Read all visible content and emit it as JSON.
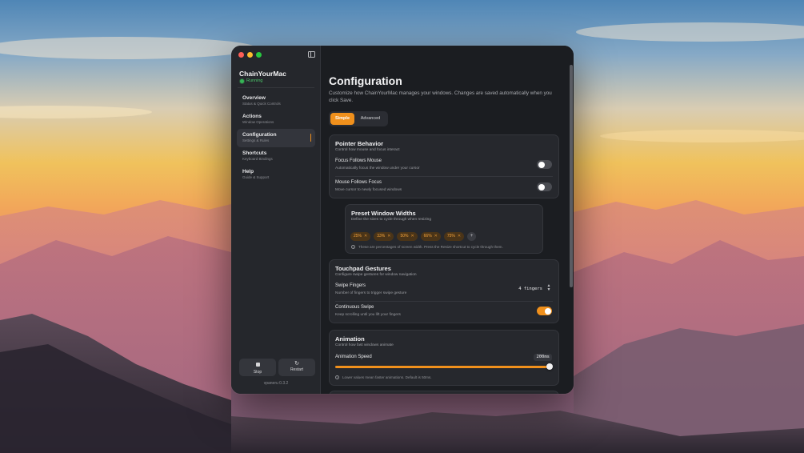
{
  "sidebar": {
    "app_name": "ChainYourMac",
    "status": "Running",
    "items": [
      {
        "label": "Overview",
        "sub": "Status & Quick Controls"
      },
      {
        "label": "Actions",
        "sub": "Window Operations"
      },
      {
        "label": "Configuration",
        "sub": "Settings & Rules"
      },
      {
        "label": "Shortcuts",
        "sub": "Keyboard Bindings"
      },
      {
        "label": "Help",
        "sub": "Guide & Support"
      }
    ],
    "stop_label": "Stop",
    "restart_label": "Restart",
    "version": "vpaneru 0.3.2"
  },
  "main": {
    "title": "Configuration",
    "description": "Customize how ChainYourMac manages your windows. Changes are saved automatically when you click Save.",
    "tabs": [
      {
        "label": "Simple",
        "active": true
      },
      {
        "label": "Advanced",
        "active": false
      }
    ],
    "pointer": {
      "title": "Pointer Behavior",
      "sub": "Control how mouse and focus interact",
      "focus_follows_mouse": {
        "label": "Focus Follows Mouse",
        "sub": "Automatically focus the window under your cursor",
        "on": false
      },
      "mouse_follows_focus": {
        "label": "Mouse Follows Focus",
        "sub": "Move cursor to newly focused windows",
        "on": false
      }
    },
    "preset": {
      "title": "Preset Window Widths",
      "sub": "Define the sizes to cycle through when resizing",
      "chips": [
        "25%",
        "33%",
        "50%",
        "66%",
        "75%"
      ],
      "add": "+",
      "info": "These are percentages of screen width. Press the Resize shortcut to cycle through them."
    },
    "touchpad": {
      "title": "Touchpad Gestures",
      "sub": "Configure swipe gestures for window navigation",
      "swipe_fingers": {
        "label": "Swipe Fingers",
        "sub": "Number of fingers to trigger swipe gesture",
        "value": "4 fingers"
      },
      "continuous_swipe": {
        "label": "Continuous Swipe",
        "sub": "Keep scrolling until you lift your fingers",
        "on": true
      }
    },
    "animation": {
      "title": "Animation",
      "sub": "Control how fast windows animate",
      "speed_label": "Animation Speed",
      "speed_value": "200ms",
      "info": "Lower values mean faster animations. Default is 50ms."
    }
  },
  "colors": {
    "accent": "#f0901c",
    "running": "#36b556"
  },
  "icons": [
    "close-button",
    "minimize-button",
    "zoom-button",
    "sidebar-toggle-icon",
    "stop-icon",
    "restart-icon",
    "info-icon",
    "chevron-updown-icon"
  ]
}
